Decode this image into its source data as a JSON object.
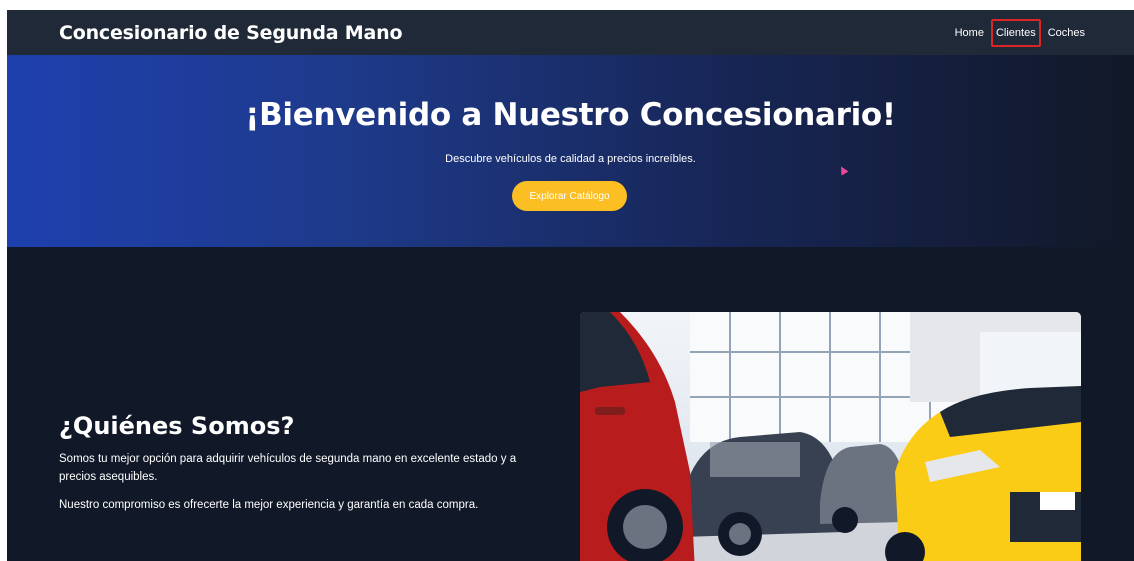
{
  "header": {
    "brand": "Concesionario de Segunda Mano",
    "nav": [
      {
        "label": "Home"
      },
      {
        "label": "Clientes",
        "active": true
      },
      {
        "label": "Coches"
      }
    ]
  },
  "hero": {
    "title": "¡Bienvenido a Nuestro Concesionario!",
    "subtitle": "Descubre vehículos de calidad a precios increíbles.",
    "cta_label": "Explorar Catálogo"
  },
  "about": {
    "title": "¿Quiénes Somos?",
    "paragraphs": [
      "Somos tu mejor opción para adquirir vehículos de segunda mano en excelente estado y a precios asequibles.",
      "Nuestro compromiso es ofrecerte la mejor experiencia y garantía en cada compra."
    ]
  },
  "colors": {
    "header_bg": "#1f2937",
    "page_bg": "#111827",
    "accent": "#fbbf24",
    "active_outline": "#dc2626"
  }
}
